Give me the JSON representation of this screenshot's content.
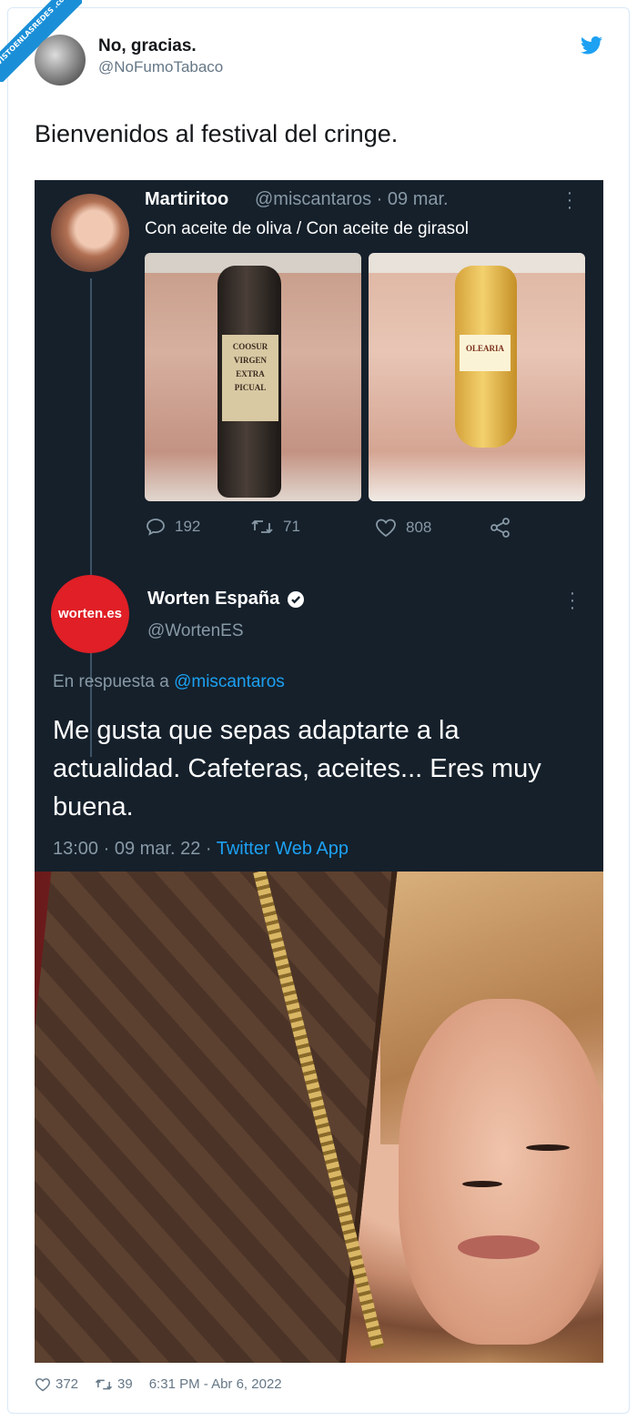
{
  "watermark": "VISTOENLASREDES .com",
  "tweet": {
    "author_name": "No, gracias.",
    "author_handle": "@NoFumoTabaco",
    "text": "Bienvenidos al festival del cringe.",
    "likes": "372",
    "retweets": "39",
    "timestamp": "6:31 PM - Abr 6, 2022"
  },
  "embedded": {
    "first": {
      "name": "Martiritoo",
      "meta": "@miscantaros · 09 mar.",
      "text": "Con aceite de oliva / Con aceite de girasol",
      "image_left_label": "COOSUR VIRGEN EXTRA PICUAL",
      "image_right_label": "OLEARIA",
      "replies": "192",
      "retweets": "71",
      "likes": "808"
    },
    "second": {
      "name": "Worten España",
      "handle": "@WortenES",
      "avatar_text": "worten.es",
      "reply_prefix": "En respuesta a ",
      "reply_mention": "@miscantaros",
      "text": "Me gusta que sepas adaptarte a la actualidad. Cafeteras, aceites... Eres muy buena.",
      "time": "13:00 · 09 mar. 22 · ",
      "app": "Twitter Web App"
    }
  },
  "colors": {
    "twitter_blue": "#1da1f2",
    "dark_bg": "#15202b",
    "worten_red": "#e01f26"
  }
}
